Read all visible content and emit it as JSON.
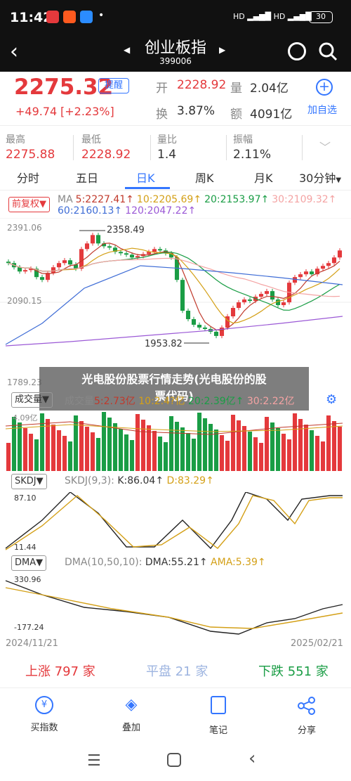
{
  "status": {
    "time": "11:42",
    "icons": [
      "app-icon-a",
      "app-icon-b",
      "app-icon-c"
    ],
    "battery": "30",
    "network": "4G"
  },
  "header": {
    "title": "创业板指",
    "code": "399006"
  },
  "quote": {
    "price": "2275.32",
    "alert_label": "提醒",
    "change": "+49.74",
    "change_pct": "[+2.23%]",
    "open_label": "开",
    "open": "2228.92",
    "volume_label": "量",
    "volume": "2.04亿",
    "turnover_label": "换",
    "turnover": "3.87%",
    "amount_label": "额",
    "amount": "4091亿",
    "watch_label": "加自选",
    "high_label": "最高",
    "high": "2275.88",
    "low_label": "最低",
    "low": "2228.92",
    "vr_label": "量比",
    "vr": "1.4",
    "amp_label": "振幅",
    "amp": "2.11%"
  },
  "tabs": [
    {
      "label": "分时"
    },
    {
      "label": "五日"
    },
    {
      "label": "日K"
    },
    {
      "label": "周K"
    },
    {
      "label": "月K"
    },
    {
      "label": "30分钟"
    }
  ],
  "kline": {
    "adj_label": "前复权",
    "ma_label": "MA",
    "ma5": "5:2227.41↑",
    "ma10": "10:2205.69↑",
    "ma20": "20:2153.97↑",
    "ma30": "30:2109.32↑",
    "ma60": "60:2160.13↑",
    "ma120": "120:2047.22↑",
    "y_top": "2391.06",
    "y_mid": "2090.15",
    "y_bot": "1789.23",
    "max_label": "2358.49",
    "min_label": "1953.82"
  },
  "overlay": {
    "text_line1": "光电股份股票行情走势(光电股份的股",
    "text_line2": "票代码)"
  },
  "volume_panel": {
    "selector": "成交量",
    "title": "成交量",
    "ma5": "5:2.73亿",
    "ma10": "10:2.4?亿",
    "ma20": "20:2.39亿↑",
    "ma30": "30:2.22亿",
    "y_top": "4.09亿"
  },
  "skdj": {
    "selector": "SKDJ",
    "params": "SKDJ(9,3):",
    "k": "K:86.04↑",
    "d": "D:83.29↑",
    "y_top": "87.10",
    "y_bot": "11.44"
  },
  "dma": {
    "selector": "DMA",
    "params": "DMA(10,50,10):",
    "dma": "DMA:55.21↑",
    "ama": "AMA:5.39↑",
    "y_top": "330.96",
    "y_bot": "-177.24"
  },
  "dates": {
    "start": "2024/11/21",
    "end": "2025/02/21"
  },
  "breadth": {
    "up": "上涨 797 家",
    "flat": "平盘 21 家",
    "down": "下跌 551 家"
  },
  "bottom_nav": [
    {
      "label": "买指数",
      "icon": "yen-coin-icon"
    },
    {
      "label": "叠加",
      "icon": "layers-icon"
    },
    {
      "label": "笔记",
      "icon": "note-icon"
    },
    {
      "label": "分享",
      "icon": "share-icon"
    }
  ],
  "colors": {
    "up": "#e4393c",
    "down": "#1a9d45",
    "accent": "#3476ff",
    "ma5": "#c0392b",
    "ma10": "#d4a017",
    "ma20": "#1a9d45",
    "ma30": "#f4a3a3",
    "ma60": "#3f6dd6",
    "ma120": "#9b59d6"
  }
}
